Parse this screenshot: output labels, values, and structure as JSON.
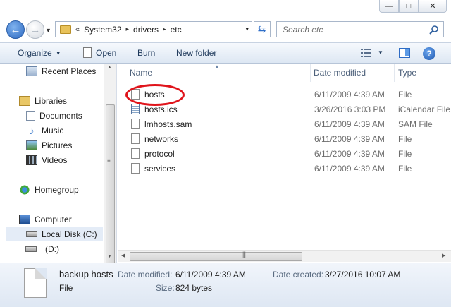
{
  "window": {
    "controls": {
      "minimize": "—",
      "maximize": "□",
      "close": "✕"
    }
  },
  "address": {
    "overflow": "«",
    "crumbs": [
      "System32",
      "drivers",
      "etc"
    ],
    "separator": "▸",
    "dropdown": "▾"
  },
  "search": {
    "placeholder": "Search etc"
  },
  "toolbar": {
    "organize": "Organize",
    "open": "Open",
    "burn": "Burn",
    "new_folder": "New folder",
    "help": "?"
  },
  "nav": {
    "items": [
      {
        "label": "Recent Places",
        "icon": "recent-places-icon"
      },
      {
        "label": "Libraries",
        "icon": "libraries-icon"
      },
      {
        "label": "Documents",
        "icon": "documents-icon"
      },
      {
        "label": "Music",
        "icon": "music-icon"
      },
      {
        "label": "Pictures",
        "icon": "pictures-icon"
      },
      {
        "label": "Videos",
        "icon": "videos-icon"
      },
      {
        "label": "Homegroup",
        "icon": "homegroup-icon"
      },
      {
        "label": "Computer",
        "icon": "computer-icon"
      },
      {
        "label": "Local Disk (C:)",
        "icon": "drive-icon",
        "selected": true
      },
      {
        "label": "(D:)",
        "icon": "drive-icon"
      }
    ]
  },
  "columns": {
    "name": "Name",
    "date_modified": "Date modified",
    "type": "Type"
  },
  "files": [
    {
      "name": "hosts",
      "date": "6/11/2009 4:39 AM",
      "type": "File",
      "icon": "file-icon",
      "highlighted": true
    },
    {
      "name": "hosts.ics",
      "date": "3/26/2016 3:03 PM",
      "type": "iCalendar File",
      "icon": "calendar-file-icon"
    },
    {
      "name": "lmhosts.sam",
      "date": "6/11/2009 4:39 AM",
      "type": "SAM File",
      "icon": "file-icon"
    },
    {
      "name": "networks",
      "date": "6/11/2009 4:39 AM",
      "type": "File",
      "icon": "file-icon"
    },
    {
      "name": "protocol",
      "date": "6/11/2009 4:39 AM",
      "type": "File",
      "icon": "file-icon"
    },
    {
      "name": "services",
      "date": "6/11/2009 4:39 AM",
      "type": "File",
      "icon": "file-icon"
    }
  ],
  "details": {
    "name": "backup hosts",
    "kind": "File",
    "modified_label": "Date modified:",
    "modified": "6/11/2009 4:39 AM",
    "created_label": "Date created:",
    "created": "3/27/2016 10:07 AM",
    "size_label": "Size:",
    "size": "824 bytes"
  },
  "colors": {
    "highlight_ring": "#e0141b",
    "toolbar_text": "#1e395b",
    "selection": "#e4ecf7"
  }
}
